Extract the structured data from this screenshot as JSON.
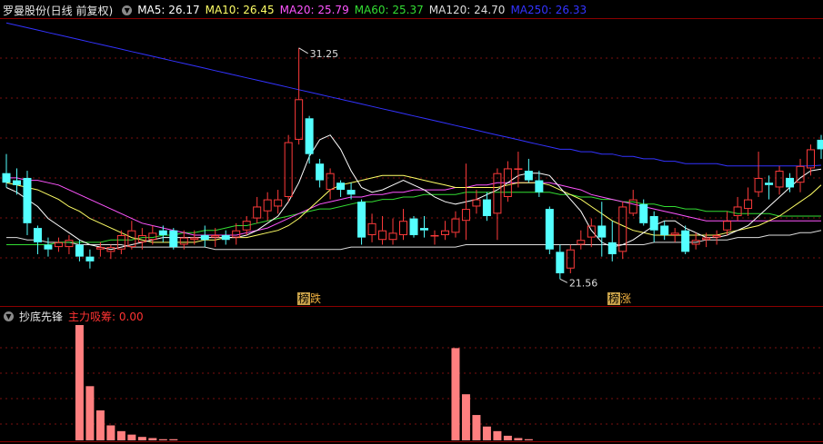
{
  "header": {
    "title": "罗曼股份(日线 前复权)",
    "ma": [
      {
        "label": "MA5: 26.17",
        "color": "#ffffff"
      },
      {
        "label": "MA10: 26.45",
        "color": "#ffff66"
      },
      {
        "label": "MA20: 25.79",
        "color": "#ff55ff"
      },
      {
        "label": "MA60: 25.37",
        "color": "#33dd33"
      },
      {
        "label": "MA120: 24.70",
        "color": "#dddddd"
      },
      {
        "label": "MA250: 26.33",
        "color": "#3333ff"
      }
    ]
  },
  "indicator": {
    "title": "抄底先锋",
    "label": "主力吸筹: 0.00",
    "label_color": "#ff3333"
  },
  "tags": [
    {
      "box": "榜",
      "text": "跌",
      "x": 325
    },
    {
      "box": "榜",
      "text": "涨",
      "x": 666
    }
  ],
  "annotations": {
    "high": "31.25",
    "low": "21.56"
  },
  "chart_data": {
    "type": "candlestick",
    "y_range": [
      21.0,
      32.5
    ],
    "candles": [
      [
        26.0,
        25.6,
        26.8,
        25.4
      ],
      [
        25.7,
        25.5,
        26.2,
        25.1
      ],
      [
        25.8,
        23.9,
        26.1,
        23.4
      ],
      [
        23.7,
        23.1,
        23.8,
        22.6
      ],
      [
        23.0,
        22.8,
        23.3,
        22.5
      ],
      [
        22.9,
        23.1,
        23.3,
        22.7
      ],
      [
        22.9,
        23.2,
        23.4,
        22.6
      ],
      [
        23.0,
        22.5,
        23.2,
        22.3
      ],
      [
        22.5,
        22.3,
        22.8,
        22.0
      ],
      [
        22.8,
        22.9,
        23.1,
        22.5
      ],
      [
        22.7,
        22.9,
        23.0,
        22.4
      ],
      [
        22.8,
        23.4,
        23.6,
        22.6
      ],
      [
        22.9,
        23.6,
        24.0,
        22.8
      ],
      [
        23.1,
        23.4,
        23.7,
        22.8
      ],
      [
        23.2,
        23.5,
        23.8,
        23.0
      ],
      [
        23.6,
        23.4,
        23.8,
        23.1
      ],
      [
        23.6,
        22.9,
        23.7,
        22.8
      ],
      [
        23.0,
        23.3,
        23.6,
        22.8
      ],
      [
        23.2,
        23.3,
        23.6,
        23.0
      ],
      [
        23.4,
        23.2,
        23.8,
        22.9
      ],
      [
        23.3,
        23.4,
        23.7,
        22.9
      ],
      [
        23.4,
        23.2,
        23.6,
        23.0
      ],
      [
        23.3,
        23.6,
        23.9,
        23.0
      ],
      [
        23.6,
        24.0,
        24.2,
        23.4
      ],
      [
        24.1,
        24.6,
        25.0,
        23.9
      ],
      [
        24.4,
        24.9,
        25.2,
        24.0
      ],
      [
        24.6,
        24.9,
        25.3,
        24.3
      ],
      [
        25.0,
        27.3,
        27.6,
        24.8
      ],
      [
        27.4,
        29.1,
        31.25,
        27.2
      ],
      [
        28.3,
        26.8,
        28.4,
        26.4
      ],
      [
        26.4,
        25.7,
        26.6,
        25.4
      ],
      [
        25.3,
        26.0,
        26.2,
        24.9
      ],
      [
        25.6,
        25.3,
        25.7,
        25.0
      ],
      [
        25.3,
        25.1,
        25.6,
        24.9
      ],
      [
        24.8,
        23.3,
        24.9,
        23.0
      ],
      [
        23.4,
        23.9,
        24.3,
        23.1
      ],
      [
        23.2,
        23.6,
        24.2,
        23.0
      ],
      [
        23.2,
        23.5,
        24.1,
        23.0
      ],
      [
        23.4,
        24.0,
        24.5,
        23.2
      ],
      [
        24.1,
        23.4,
        24.2,
        23.3
      ],
      [
        23.7,
        23.6,
        24.2,
        23.3
      ],
      [
        23.4,
        23.4,
        23.6,
        23.0
      ],
      [
        23.4,
        23.6,
        24.0,
        23.2
      ],
      [
        23.5,
        24.1,
        24.4,
        23.3
      ],
      [
        24.0,
        24.5,
        26.4,
        23.2
      ],
      [
        24.6,
        24.9,
        25.3,
        24.3
      ],
      [
        24.9,
        24.2,
        25.2,
        24.0
      ],
      [
        24.3,
        26.0,
        26.2,
        23.2
      ],
      [
        25.0,
        26.2,
        26.5,
        24.8
      ],
      [
        26.2,
        26.2,
        26.9,
        25.4
      ],
      [
        26.1,
        25.7,
        26.6,
        25.6
      ],
      [
        25.7,
        25.2,
        26.1,
        25.0
      ],
      [
        24.5,
        22.8,
        24.6,
        22.6
      ],
      [
        22.7,
        21.8,
        23.0,
        21.56
      ],
      [
        22.0,
        22.8,
        23.0,
        21.8
      ],
      [
        23.0,
        23.2,
        23.6,
        22.8
      ],
      [
        23.3,
        23.8,
        24.1,
        22.9
      ],
      [
        23.8,
        23.3,
        24.8,
        22.5
      ],
      [
        23.1,
        22.6,
        24.0,
        22.3
      ],
      [
        22.7,
        24.6,
        24.8,
        22.4
      ],
      [
        24.3,
        24.9,
        25.3,
        24.2
      ],
      [
        24.7,
        23.9,
        24.9,
        23.8
      ],
      [
        24.2,
        23.6,
        24.4,
        23.1
      ],
      [
        23.8,
        23.4,
        24.0,
        23.2
      ],
      [
        23.4,
        23.5,
        23.7,
        23.1
      ],
      [
        23.6,
        22.7,
        23.8,
        22.6
      ],
      [
        23.0,
        23.2,
        23.5,
        22.8
      ],
      [
        23.2,
        23.3,
        23.5,
        22.9
      ],
      [
        23.3,
        23.4,
        23.6,
        23.0
      ],
      [
        23.6,
        24.0,
        24.4,
        23.4
      ],
      [
        24.2,
        24.6,
        25.0,
        24.0
      ],
      [
        24.5,
        24.9,
        25.4,
        24.2
      ],
      [
        25.2,
        25.8,
        26.9,
        25.0
      ],
      [
        25.6,
        25.5,
        25.9,
        24.9
      ],
      [
        25.4,
        26.1,
        26.3,
        25.1
      ],
      [
        25.8,
        25.4,
        26.0,
        25.2
      ],
      [
        25.6,
        26.3,
        26.6,
        25.2
      ],
      [
        26.2,
        27.0,
        27.2,
        25.9
      ],
      [
        27.4,
        27.0,
        27.6,
        26.6
      ]
    ],
    "ma5": [
      25.4,
      25.2,
      24.9,
      24.6,
      24.1,
      23.8,
      23.5,
      23.2,
      23.0,
      22.9,
      22.8,
      22.9,
      23.0,
      23.1,
      23.2,
      23.3,
      23.3,
      23.3,
      23.3,
      23.3,
      23.3,
      23.3,
      23.3,
      23.4,
      23.6,
      23.9,
      24.2,
      24.8,
      25.6,
      26.7,
      27.4,
      27.6,
      27.0,
      26.1,
      25.4,
      25.2,
      25.3,
      25.5,
      25.7,
      25.5,
      25.3,
      25.0,
      24.8,
      24.7,
      24.8,
      24.9,
      25.1,
      25.3,
      25.6,
      25.9,
      26.0,
      26.0,
      25.9,
      25.4,
      24.9,
      24.4,
      23.6,
      23.1,
      22.9,
      23.0,
      23.2,
      23.5,
      23.8,
      24.0,
      24.0,
      23.7,
      23.5,
      23.3,
      23.3,
      23.4,
      23.6,
      23.8,
      24.2,
      24.6,
      25.0,
      25.4,
      25.8,
      26.1,
      26.17
    ],
    "ma10": [
      25.6,
      25.5,
      25.4,
      25.3,
      25.1,
      24.9,
      24.6,
      24.4,
      24.1,
      23.9,
      23.7,
      23.5,
      23.3,
      23.2,
      23.1,
      23.1,
      23.1,
      23.1,
      23.1,
      23.2,
      23.2,
      23.3,
      23.3,
      23.3,
      23.4,
      23.5,
      23.6,
      23.8,
      24.1,
      24.5,
      24.9,
      25.3,
      25.5,
      25.6,
      25.7,
      25.8,
      25.9,
      25.9,
      25.9,
      25.8,
      25.7,
      25.6,
      25.5,
      25.4,
      25.4,
      25.4,
      25.4,
      25.4,
      25.5,
      25.6,
      25.6,
      25.6,
      25.5,
      25.3,
      25.1,
      24.9,
      24.6,
      24.3,
      24.0,
      23.8,
      23.6,
      23.5,
      23.4,
      23.4,
      23.4,
      23.4,
      23.4,
      23.4,
      23.4,
      23.5,
      23.6,
      23.7,
      23.8,
      24.0,
      24.2,
      24.5,
      24.8,
      25.1,
      25.5
    ],
    "ma20": [
      25.8,
      25.8,
      25.7,
      25.7,
      25.6,
      25.5,
      25.3,
      25.1,
      24.9,
      24.7,
      24.5,
      24.3,
      24.1,
      23.9,
      23.8,
      23.7,
      23.6,
      23.5,
      23.4,
      23.4,
      23.4,
      23.4,
      23.4,
      23.5,
      23.6,
      23.7,
      23.9,
      24.1,
      24.3,
      24.5,
      24.7,
      24.8,
      24.9,
      25.0,
      25.0,
      25.1,
      25.1,
      25.2,
      25.2,
      25.3,
      25.3,
      25.3,
      25.3,
      25.4,
      25.4,
      25.5,
      25.5,
      25.6,
      25.6,
      25.6,
      25.6,
      25.6,
      25.6,
      25.5,
      25.4,
      25.3,
      25.1,
      25.0,
      24.9,
      24.8,
      24.7,
      24.6,
      24.5,
      24.4,
      24.3,
      24.2,
      24.1,
      24.0,
      24.0,
      24.0,
      24.0,
      24.0,
      24.0,
      24.0,
      24.0,
      24.0,
      24.0,
      24.0,
      24.0
    ],
    "ma60": [
      23.0,
      23.0,
      23.0,
      23.0,
      23.0,
      23.1,
      23.1,
      23.1,
      23.1,
      23.1,
      23.2,
      23.2,
      23.2,
      23.3,
      23.3,
      23.4,
      23.4,
      23.5,
      23.5,
      23.6,
      23.6,
      23.7,
      23.8,
      23.8,
      23.9,
      24.0,
      24.1,
      24.2,
      24.3,
      24.4,
      24.5,
      24.5,
      24.6,
      24.7,
      24.8,
      24.8,
      24.9,
      24.9,
      25.0,
      25.0,
      25.1,
      25.1,
      25.1,
      25.1,
      25.2,
      25.2,
      25.2,
      25.2,
      25.2,
      25.2,
      25.2,
      25.2,
      25.2,
      25.1,
      25.1,
      25.0,
      25.0,
      24.9,
      24.9,
      24.8,
      24.8,
      24.7,
      24.7,
      24.6,
      24.6,
      24.5,
      24.5,
      24.4,
      24.4,
      24.4,
      24.3,
      24.3,
      24.3,
      24.3,
      24.2,
      24.2,
      24.2,
      24.2,
      24.2
    ],
    "ma120": [
      23.3,
      23.3,
      23.2,
      23.2,
      23.1,
      23.1,
      23.1,
      23.0,
      23.0,
      23.0,
      23.0,
      23.0,
      22.9,
      22.9,
      22.9,
      22.9,
      22.9,
      22.9,
      22.9,
      22.9,
      22.8,
      22.8,
      22.8,
      22.8,
      22.8,
      22.8,
      22.8,
      22.8,
      22.8,
      22.8,
      22.8,
      22.8,
      22.8,
      22.9,
      22.9,
      22.9,
      22.9,
      22.9,
      22.9,
      22.9,
      22.9,
      22.9,
      22.9,
      22.9,
      23.0,
      23.0,
      23.0,
      23.0,
      23.0,
      23.0,
      23.0,
      23.0,
      23.0,
      23.0,
      23.0,
      23.0,
      23.0,
      23.0,
      23.0,
      23.0,
      23.0,
      23.0,
      23.1,
      23.1,
      23.1,
      23.1,
      23.1,
      23.2,
      23.2,
      23.2,
      23.3,
      23.3,
      23.3,
      23.4,
      23.4,
      23.4,
      23.5,
      23.5,
      23.6
    ],
    "ma250": [
      32.3,
      32.2,
      32.1,
      32.0,
      31.9,
      31.8,
      31.7,
      31.6,
      31.5,
      31.4,
      31.3,
      31.2,
      31.1,
      31.0,
      30.9,
      30.8,
      30.7,
      30.6,
      30.5,
      30.4,
      30.3,
      30.2,
      30.1,
      30.0,
      29.9,
      29.8,
      29.7,
      29.6,
      29.5,
      29.4,
      29.3,
      29.2,
      29.1,
      29.0,
      28.9,
      28.8,
      28.7,
      28.6,
      28.5,
      28.4,
      28.3,
      28.2,
      28.1,
      28.0,
      27.9,
      27.8,
      27.7,
      27.6,
      27.5,
      27.4,
      27.3,
      27.2,
      27.1,
      27.0,
      27.0,
      26.9,
      26.9,
      26.8,
      26.8,
      26.7,
      26.7,
      26.6,
      26.6,
      26.5,
      26.5,
      26.4,
      26.4,
      26.4,
      26.4,
      26.3,
      26.3,
      26.3,
      26.3,
      26.3,
      26.3,
      26.3,
      26.3,
      26.3,
      26.33
    ],
    "indicator_bars": [
      {
        "i": 7,
        "v": 100
      },
      {
        "i": 8,
        "v": 47
      },
      {
        "i": 9,
        "v": 26
      },
      {
        "i": 10,
        "v": 13
      },
      {
        "i": 11,
        "v": 8
      },
      {
        "i": 12,
        "v": 5
      },
      {
        "i": 13,
        "v": 3
      },
      {
        "i": 14,
        "v": 2
      },
      {
        "i": 15,
        "v": 1
      },
      {
        "i": 16,
        "v": 1
      },
      {
        "i": 43,
        "v": 80
      },
      {
        "i": 44,
        "v": 40
      },
      {
        "i": 45,
        "v": 22
      },
      {
        "i": 46,
        "v": 12
      },
      {
        "i": 47,
        "v": 8
      },
      {
        "i": 48,
        "v": 4
      },
      {
        "i": 49,
        "v": 2
      },
      {
        "i": 50,
        "v": 1
      }
    ]
  }
}
